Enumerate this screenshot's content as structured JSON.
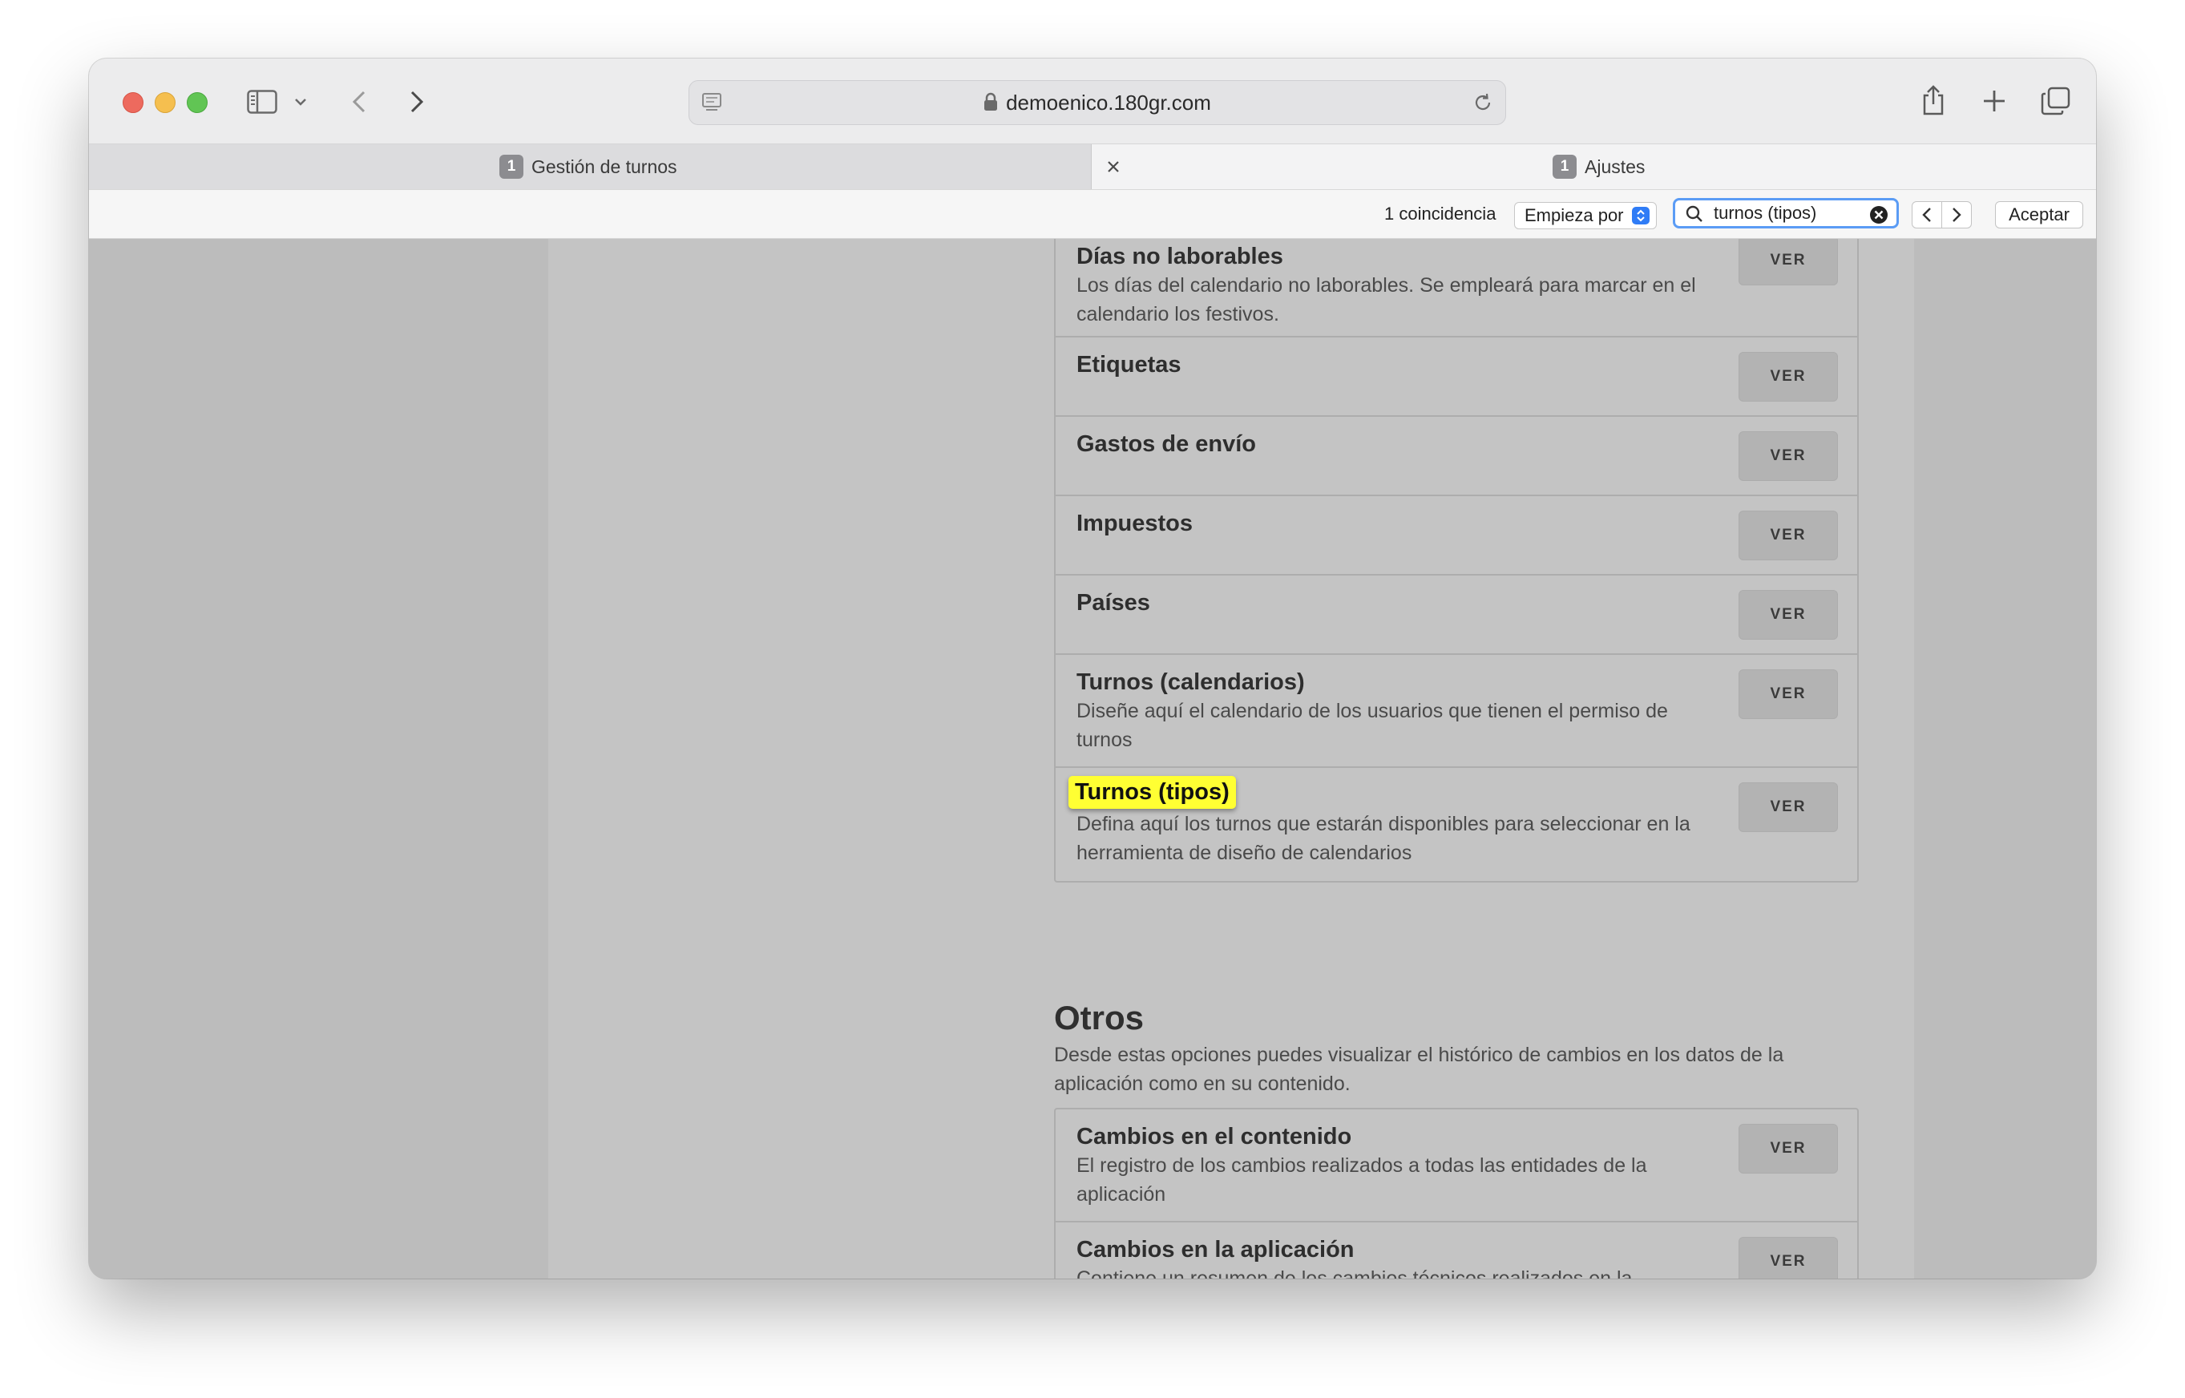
{
  "browser": {
    "url": "demoenico.180gr.com",
    "tabs": [
      {
        "badge": "1",
        "label": "Gestión de turnos"
      },
      {
        "badge": "1",
        "label": "Ajustes"
      }
    ],
    "find": {
      "count_label": "1 coincidencia",
      "mode_label": "Empieza por",
      "query": "turnos (tipos)",
      "done_label": "Aceptar"
    }
  },
  "section_list": {
    "button_label": "VER",
    "items": [
      {
        "title": "Días no laborables",
        "desc": "Los días del calendario no laborables. Se empleará para marcar en el calendario los festivos."
      },
      {
        "title": "Etiquetas",
        "desc": ""
      },
      {
        "title": "Gastos de envío",
        "desc": ""
      },
      {
        "title": "Impuestos",
        "desc": ""
      },
      {
        "title": "Países",
        "desc": ""
      },
      {
        "title": "Turnos (calendarios)",
        "desc": "Diseñe aquí el calendario de los usuarios que tienen el permiso de turnos"
      },
      {
        "title": "Turnos (tipos)",
        "desc": "Defina aquí los turnos que estarán disponibles para seleccionar en la herramienta de diseño de calendarios"
      }
    ]
  },
  "otros": {
    "title": "Otros",
    "desc": "Desde estas opciones puedes visualizar el histórico de cambios en los datos de la aplicación como en su contenido.",
    "items": [
      {
        "title": "Cambios en el contenido",
        "desc": "El registro de los cambios realizados a todas las entidades de la aplicación"
      },
      {
        "title": "Cambios en la aplicación",
        "desc": "Contiene un resumen de los cambios técnicos realizados en la aplicación"
      }
    ]
  },
  "colors": {
    "highlight": "#ffff33",
    "find_focus": "#5b9cf5",
    "traffic_red": "#ed6a5e",
    "traffic_yellow": "#f5bf4f",
    "traffic_green": "#61c554"
  },
  "icons": [
    "sidebar-toggle-icon",
    "chevron-down-icon",
    "back-icon",
    "forward-icon",
    "page-icon",
    "lock-icon",
    "reload-icon",
    "share-icon",
    "new-tab-icon",
    "tab-overview-icon",
    "close-tab-icon",
    "search-icon",
    "clear-icon",
    "previous-match-icon",
    "next-match-icon"
  ]
}
